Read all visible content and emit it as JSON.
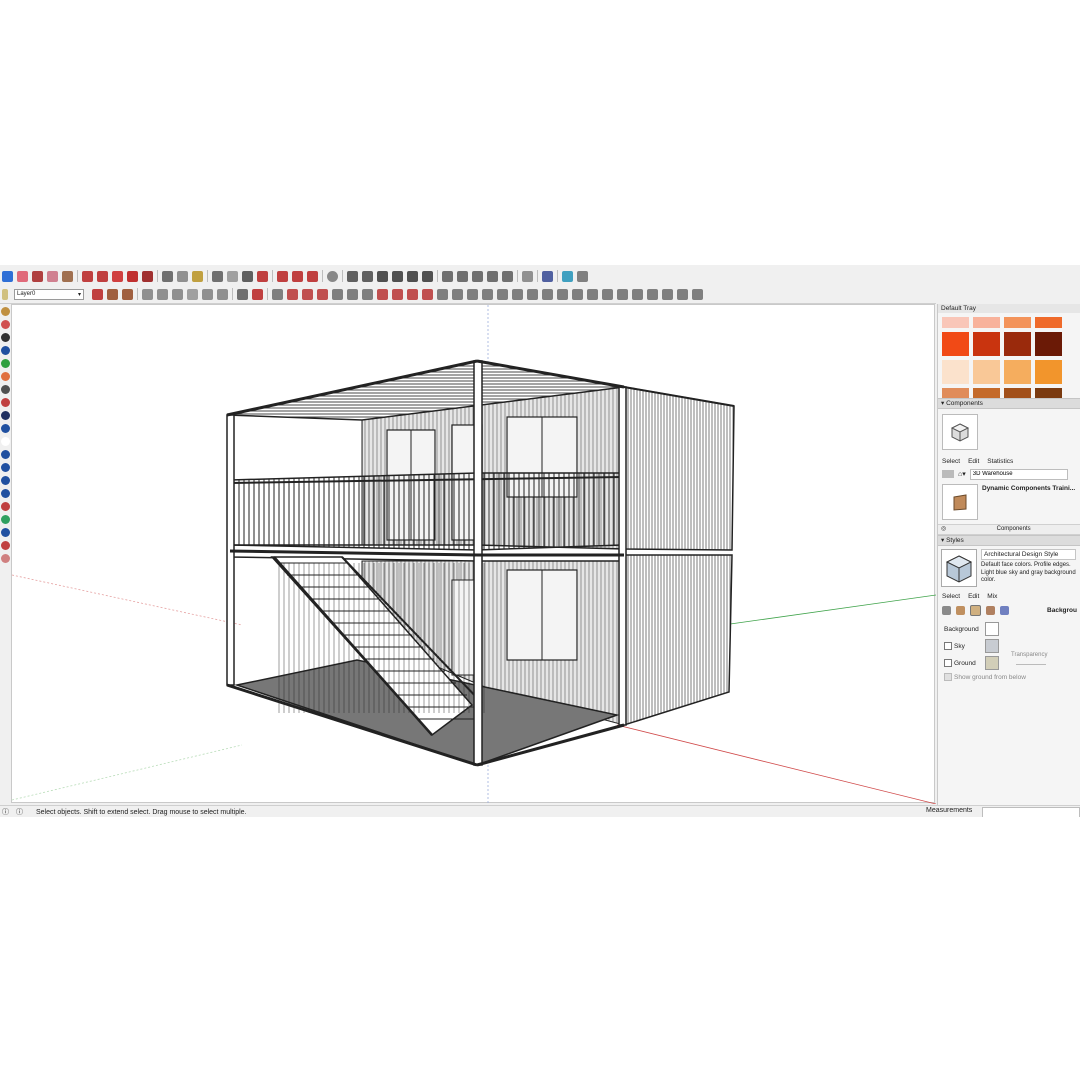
{
  "toolbar": {
    "layer_value": "Layer0"
  },
  "colors": {
    "selection_blue": "#2f6fd6",
    "axis_red": "#d04a4a",
    "axis_green": "#3fa34a",
    "axis_blue": "#4a6fd0"
  },
  "tray": {
    "title": "Default Tray",
    "swatches": [
      "#f9c6b8",
      "#f8b29b",
      "#f3935a",
      "#ef6a2a",
      "#f14a16",
      "#c9340f",
      "#9a2a0c",
      "#6b1a06",
      "#fbe2cc",
      "#f9c897",
      "#f5ad5e",
      "#f2952c",
      "#e08c5a",
      "#c46a2a",
      "#a2501a",
      "#7a3a10"
    ],
    "components": {
      "header": "Components",
      "tab_select": "Select",
      "tab_edit": "Edit",
      "tab_statistics": "Statistics",
      "search_value": "3D Warehouse",
      "item_title": "Dynamic Components Traini...",
      "footer": "Components"
    },
    "styles": {
      "header": "Styles",
      "name": "Architectural Design Style",
      "description": "Default face colors. Profile edges. Light blue sky and gray background color.",
      "tab_select": "Select",
      "tab_edit": "Edit",
      "tab_mix": "Mix",
      "panel_label": "Backgrou",
      "background_label": "Background",
      "sky_label": "Sky",
      "ground_label": "Ground",
      "transparency_label": "Transparency",
      "show_ground_label": "Show ground from below",
      "background_color": "#ffffff",
      "sky_color": "#c8ccd2",
      "ground_color": "#d2ceb8"
    }
  },
  "status": {
    "message": "Select objects. Shift to extend select. Drag mouse to select multiple.",
    "measurements_label": "Measurements"
  }
}
